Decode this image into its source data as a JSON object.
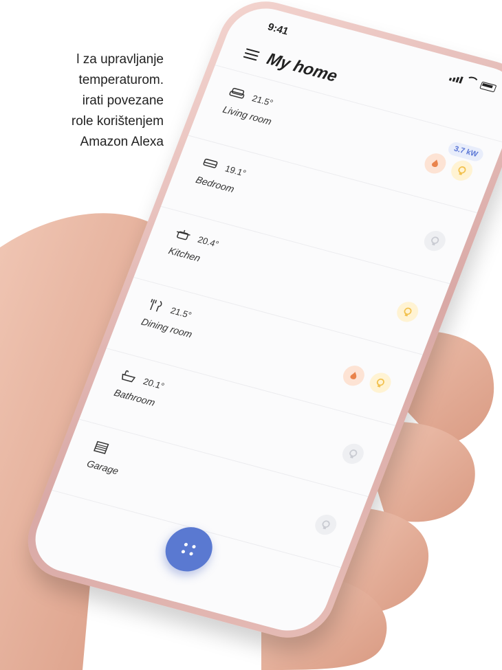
{
  "background_text": {
    "lines": [
      "l za upravljanje",
      "temperaturom.",
      "irati   povezane",
      "role korištenjem",
      "Amazon   Alexa"
    ]
  },
  "status_bar": {
    "time": "9:41"
  },
  "header": {
    "title": "My home",
    "menu_icon": "hamburger-menu-icon"
  },
  "power_badge": "3.7 kW",
  "rooms": [
    {
      "name": "Living room",
      "temp": "21.5°",
      "icon": "sofa-icon"
    },
    {
      "name": "Bedroom",
      "temp": "19.1°",
      "icon": "bed-icon"
    },
    {
      "name": "Kitchen",
      "temp": "20.4°",
      "icon": "pot-icon"
    },
    {
      "name": "Dining room",
      "temp": "21.5°",
      "icon": "cutlery-icon"
    },
    {
      "name": "Bathroom",
      "temp": "20.1°",
      "icon": "bathtub-icon"
    },
    {
      "name": "Garage",
      "temp": "",
      "icon": "garage-door-icon"
    }
  ],
  "colors": {
    "accent": "#5a79d1",
    "phone_frame": "#e3b7b1",
    "bulb_on": "#f2c14e",
    "flame_on": "#e9834b",
    "device_off": "#c9cbd2"
  },
  "fab": {
    "icon": "grid-dots-icon"
  }
}
